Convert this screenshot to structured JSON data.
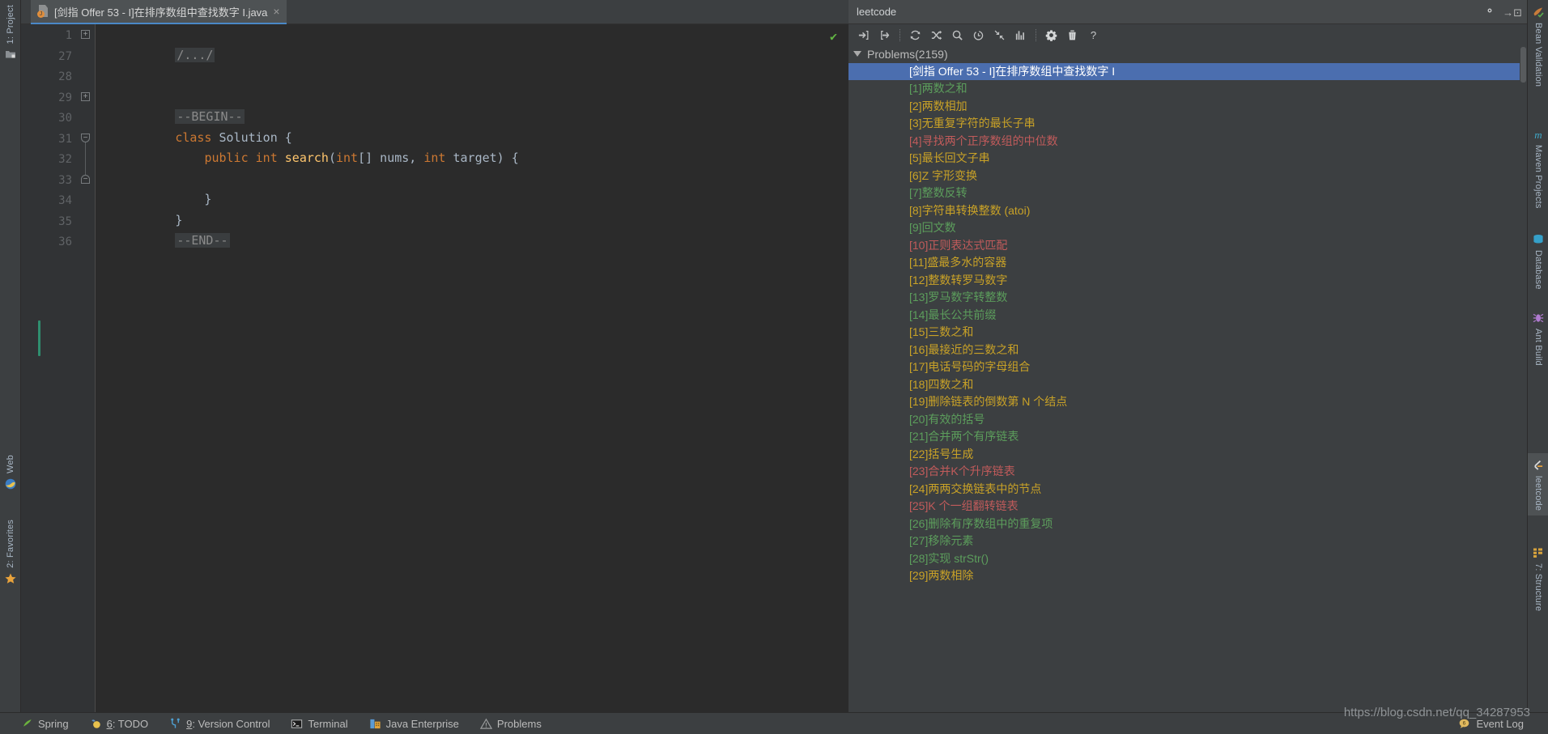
{
  "window": {
    "left_tool_tabs": [
      {
        "label": "1: Project",
        "icon": "project-icon"
      },
      {
        "label": "Web",
        "icon": "web-icon"
      },
      {
        "label": "2: Favorites",
        "icon": "star-icon"
      }
    ],
    "right_tool_tabs": [
      {
        "label": "Bean Validation",
        "icon": "bean-validation-icon",
        "active": false
      },
      {
        "label": "Maven Projects",
        "icon": "maven-icon",
        "active": false
      },
      {
        "label": "Database",
        "icon": "database-icon",
        "active": false
      },
      {
        "label": "Ant Build",
        "icon": "ant-build-icon",
        "active": false
      },
      {
        "label": "leetcode",
        "icon": "leetcode-icon",
        "active": true
      },
      {
        "label": "7: Structure",
        "icon": "structure-icon",
        "active": false
      }
    ]
  },
  "editor": {
    "tab": {
      "title": "[剑指 Offer 53 - I]在排序数组中查找数字 I.java",
      "close_label": "×",
      "icon": "java-file-icon"
    },
    "inspection_status": "✔",
    "lines": [
      {
        "num": "1",
        "kind": "collapsed",
        "text": "/.../",
        "fold": "+"
      },
      {
        "num": "27",
        "kind": "blank",
        "text": ""
      },
      {
        "num": "28",
        "kind": "blank",
        "text": ""
      },
      {
        "num": "29",
        "kind": "marker",
        "text": "--BEGIN--",
        "fold": "+"
      },
      {
        "num": "30",
        "kind": "code",
        "text": "class Solution {"
      },
      {
        "num": "31",
        "kind": "code",
        "text": "    public int search(int[] nums, int target) {"
      },
      {
        "num": "32",
        "kind": "blank",
        "text": ""
      },
      {
        "num": "33",
        "kind": "code",
        "text": "    }"
      },
      {
        "num": "34",
        "kind": "code",
        "text": "}"
      },
      {
        "num": "35",
        "kind": "marker",
        "text": "--END--"
      },
      {
        "num": "36",
        "kind": "blank",
        "text": ""
      }
    ]
  },
  "leetcode": {
    "panel_title": "leetcode",
    "header_icons": [
      {
        "name": "gear-icon",
        "label": "Settings"
      },
      {
        "name": "hide-icon",
        "label": "Hide"
      }
    ],
    "toolbar": [
      {
        "name": "sign-in-icon",
        "label": "Login"
      },
      {
        "name": "sign-out-icon",
        "label": "Logout"
      },
      {
        "name": "refresh-icon",
        "label": "Refresh"
      },
      {
        "name": "shuffle-icon",
        "label": "Random Question"
      },
      {
        "name": "search-icon",
        "label": "Search"
      },
      {
        "name": "clock-icon",
        "label": "Timer"
      },
      {
        "name": "collapse-all-icon",
        "label": "Collapse All"
      },
      {
        "name": "chart-icon",
        "label": "Statistics"
      },
      {
        "name": "settings-icon",
        "label": "Config"
      },
      {
        "name": "trash-icon",
        "label": "Clear Cache"
      },
      {
        "name": "help-icon",
        "label": "Help"
      }
    ],
    "tree_root": "Problems(2159)",
    "difficulty_colors": {
      "easy": "#5c9e5c",
      "medium": "#c9a227",
      "hard": "#c15b5b",
      "selected_bg": "#4b6eaf",
      "selected_fg": "#ffffff"
    },
    "problems": [
      {
        "label": "[剑指 Offer 53 - I]在排序数组中查找数字 I",
        "difficulty": "selected"
      },
      {
        "label": "[1]两数之和",
        "difficulty": "easy"
      },
      {
        "label": "[2]两数相加",
        "difficulty": "medium"
      },
      {
        "label": "[3]无重复字符的最长子串",
        "difficulty": "medium"
      },
      {
        "label": "[4]寻找两个正序数组的中位数",
        "difficulty": "hard"
      },
      {
        "label": "[5]最长回文子串",
        "difficulty": "medium"
      },
      {
        "label": "[6]Z 字形变换",
        "difficulty": "medium"
      },
      {
        "label": "[7]整数反转",
        "difficulty": "easy"
      },
      {
        "label": "[8]字符串转换整数 (atoi)",
        "difficulty": "medium"
      },
      {
        "label": "[9]回文数",
        "difficulty": "easy"
      },
      {
        "label": "[10]正则表达式匹配",
        "difficulty": "hard"
      },
      {
        "label": "[11]盛最多水的容器",
        "difficulty": "medium"
      },
      {
        "label": "[12]整数转罗马数字",
        "difficulty": "medium"
      },
      {
        "label": "[13]罗马数字转整数",
        "difficulty": "easy"
      },
      {
        "label": "[14]最长公共前缀",
        "difficulty": "easy"
      },
      {
        "label": "[15]三数之和",
        "difficulty": "medium"
      },
      {
        "label": "[16]最接近的三数之和",
        "difficulty": "medium"
      },
      {
        "label": "[17]电话号码的字母组合",
        "difficulty": "medium"
      },
      {
        "label": "[18]四数之和",
        "difficulty": "medium"
      },
      {
        "label": "[19]删除链表的倒数第 N 个结点",
        "difficulty": "medium"
      },
      {
        "label": "[20]有效的括号",
        "difficulty": "easy"
      },
      {
        "label": "[21]合并两个有序链表",
        "difficulty": "easy"
      },
      {
        "label": "[22]括号生成",
        "difficulty": "medium"
      },
      {
        "label": "[23]合并K个升序链表",
        "difficulty": "hard"
      },
      {
        "label": "[24]两两交换链表中的节点",
        "difficulty": "medium"
      },
      {
        "label": "[25]K 个一组翻转链表",
        "difficulty": "hard"
      },
      {
        "label": "[26]删除有序数组中的重复项",
        "difficulty": "easy"
      },
      {
        "label": "[27]移除元素",
        "difficulty": "easy"
      },
      {
        "label": "[28]实现 strStr()",
        "difficulty": "easy"
      },
      {
        "label": "[29]两数相除",
        "difficulty": "medium"
      }
    ]
  },
  "statusbar": {
    "items": [
      {
        "label": "Spring",
        "icon": "spring-icon",
        "mnemonic": ""
      },
      {
        "label": ": TODO",
        "icon": "todo-icon",
        "mnemonic": "6"
      },
      {
        "label": ": Version Control",
        "icon": "vcs-icon",
        "mnemonic": "9"
      },
      {
        "label": "Terminal",
        "icon": "terminal-icon",
        "mnemonic": ""
      },
      {
        "label": "Java Enterprise",
        "icon": "java-enterprise-icon",
        "mnemonic": ""
      },
      {
        "label": "Problems",
        "icon": "problems-icon",
        "mnemonic": ""
      }
    ],
    "event_log": "Event Log"
  },
  "watermark": "https://blog.csdn.net/qq_34287953"
}
